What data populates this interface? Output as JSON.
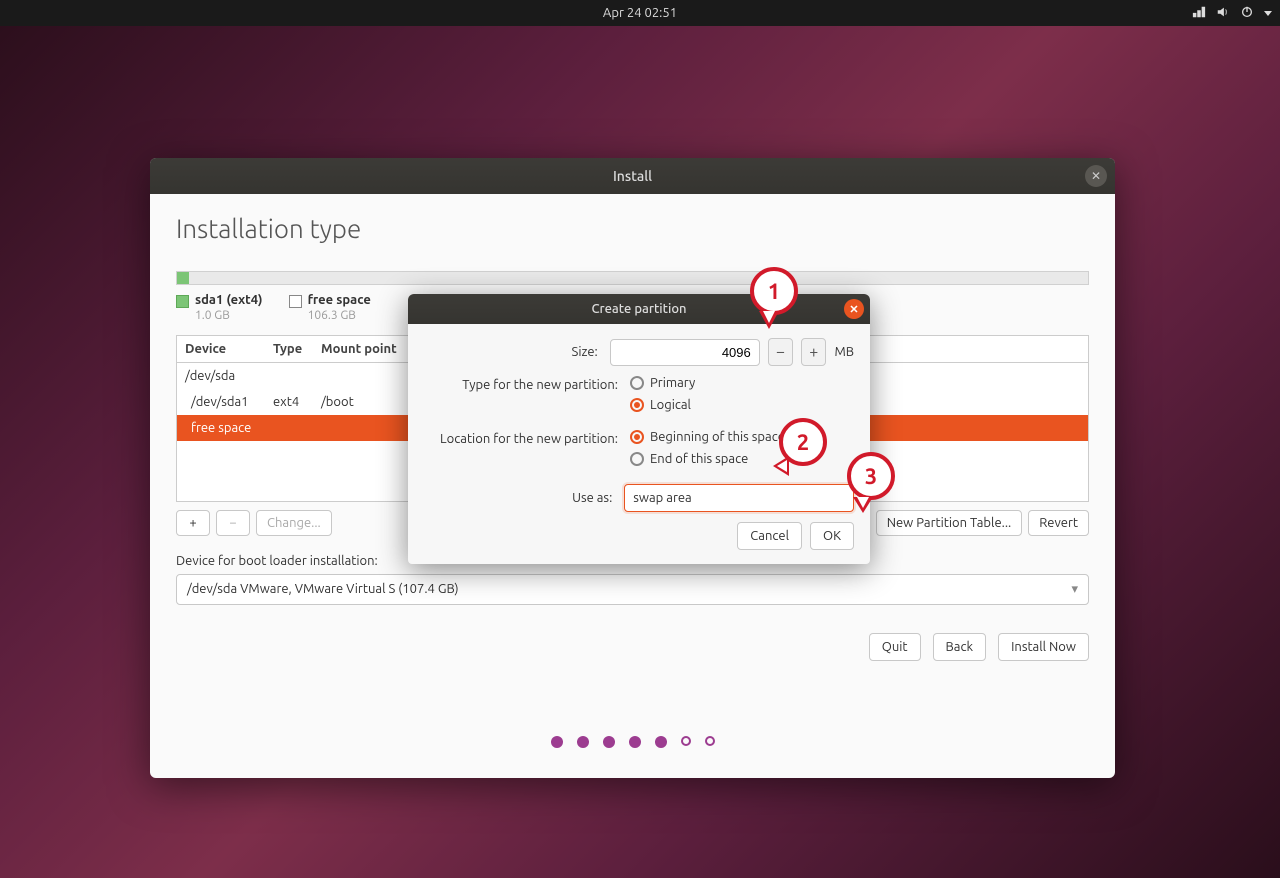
{
  "topbar": {
    "datetime": "Apr 24  02:51"
  },
  "install": {
    "window_title": "Install",
    "page_title": "Installation type",
    "legend": {
      "part1_name": "sda1 (ext4)",
      "part1_size": "1.0 GB",
      "free_name": "free space",
      "free_size": "106.3 GB"
    },
    "table": {
      "col_device": "Device",
      "col_type": "Type",
      "col_mount": "Mount point",
      "rows": [
        {
          "device": "/dev/sda",
          "type": "",
          "mount": ""
        },
        {
          "device": "/dev/sda1",
          "type": "ext4",
          "mount": "/boot"
        },
        {
          "device": "free space",
          "type": "",
          "mount": ""
        }
      ]
    },
    "buttons": {
      "add": "+",
      "remove": "−",
      "change": "Change...",
      "new_table": "New Partition Table...",
      "revert": "Revert",
      "quit": "Quit",
      "back": "Back",
      "install_now": "Install Now"
    },
    "bootloader_label": "Device for boot loader installation:",
    "bootloader_value": "/dev/sda   VMware, VMware Virtual S (107.4 GB)"
  },
  "cp": {
    "title": "Create partition",
    "size_label": "Size:",
    "size_value": "4096",
    "size_unit": "MB",
    "type_label": "Type for the new partition:",
    "type_primary": "Primary",
    "type_logical": "Logical",
    "location_label": "Location for the new partition:",
    "loc_begin": "Beginning of this space",
    "loc_end": "End of this space",
    "useas_label": "Use as:",
    "useas_value": "swap area",
    "cancel": "Cancel",
    "ok": "OK"
  },
  "annotations": {
    "b1": "1",
    "b2": "2",
    "b3": "3"
  }
}
